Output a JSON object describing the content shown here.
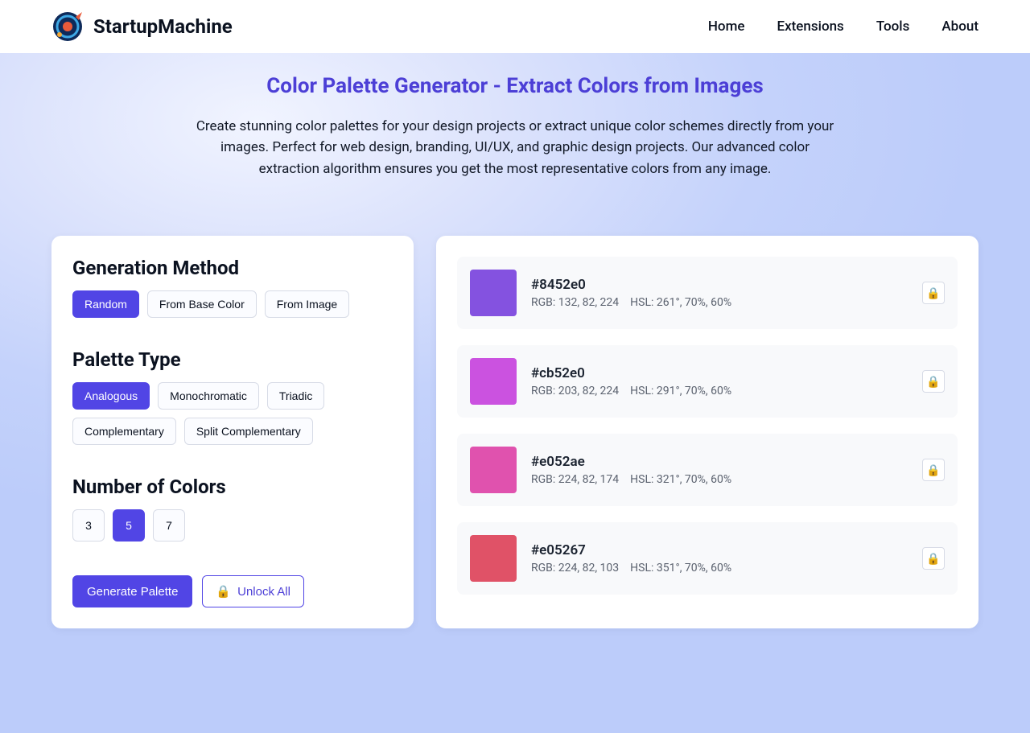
{
  "header": {
    "brand": "StartupMachine",
    "nav": [
      "Home",
      "Extensions",
      "Tools",
      "About"
    ]
  },
  "hero": {
    "title": "Color Palette Generator - Extract Colors from Images",
    "description": "Create stunning color palettes for your design projects or extract unique color schemes directly from your images. Perfect for web design, branding, UI/UX, and graphic design projects. Our advanced color extraction algorithm ensures you get the most representative colors from any image."
  },
  "generation": {
    "title": "Generation Method",
    "options": [
      {
        "label": "Random",
        "active": true
      },
      {
        "label": "From Base Color",
        "active": false
      },
      {
        "label": "From Image",
        "active": false
      }
    ]
  },
  "paletteType": {
    "title": "Palette Type",
    "options": [
      {
        "label": "Analogous",
        "active": true
      },
      {
        "label": "Monochromatic",
        "active": false
      },
      {
        "label": "Triadic",
        "active": false
      },
      {
        "label": "Complementary",
        "active": false
      },
      {
        "label": "Split Complementary",
        "active": false
      }
    ]
  },
  "numColors": {
    "title": "Number of Colors",
    "options": [
      {
        "label": "3",
        "active": false
      },
      {
        "label": "5",
        "active": true
      },
      {
        "label": "7",
        "active": false
      }
    ]
  },
  "actions": {
    "generate": "Generate Palette",
    "unlock": "Unlock All"
  },
  "palette": [
    {
      "hex": "#8452e0",
      "rgb": "RGB: 132, 82, 224",
      "hsl": "HSL: 261°, 70%, 60%",
      "color": "#8452e0"
    },
    {
      "hex": "#cb52e0",
      "rgb": "RGB: 203, 82, 224",
      "hsl": "HSL: 291°, 70%, 60%",
      "color": "#cb52e0"
    },
    {
      "hex": "#e052ae",
      "rgb": "RGB: 224, 82, 174",
      "hsl": "HSL: 321°, 70%, 60%",
      "color": "#e052ae"
    },
    {
      "hex": "#e05267",
      "rgb": "RGB: 224, 82, 103",
      "hsl": "HSL: 351°, 70%, 60%",
      "color": "#e05267"
    }
  ]
}
